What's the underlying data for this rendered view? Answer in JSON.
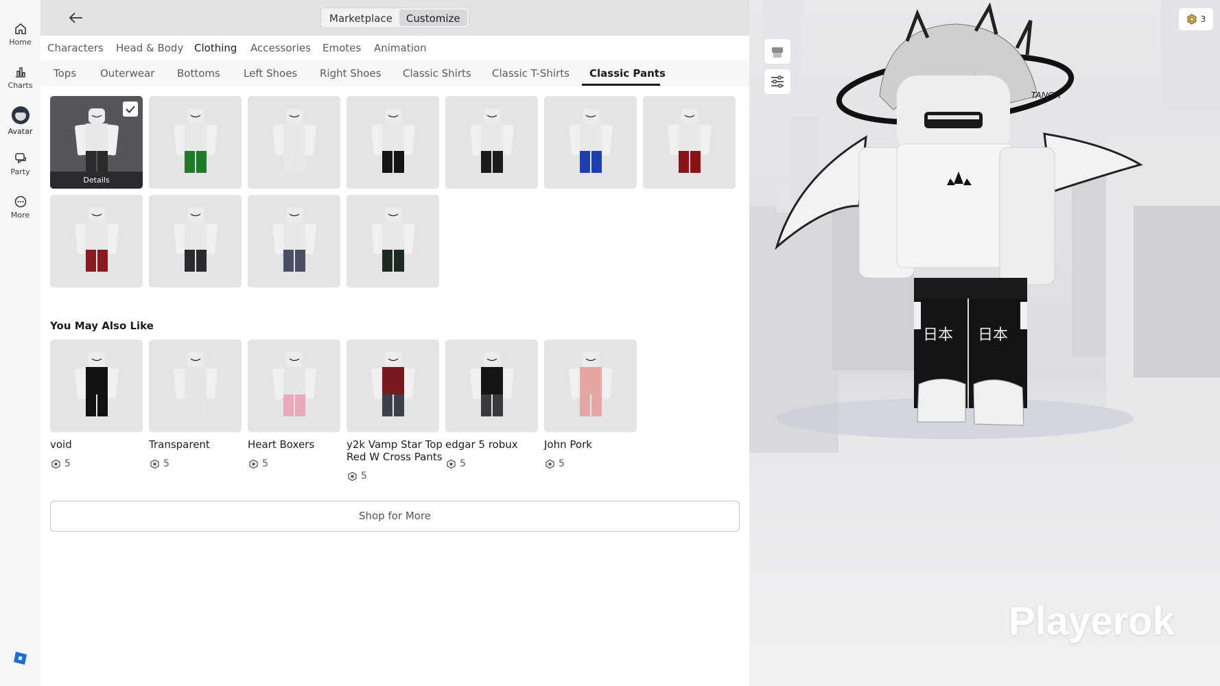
{
  "nav": {
    "items": [
      {
        "label": "Home",
        "icon": "home-icon"
      },
      {
        "label": "Charts",
        "icon": "chart-icon"
      },
      {
        "label": "Avatar",
        "icon": "avatar-icon"
      },
      {
        "label": "Party",
        "icon": "party-icon"
      },
      {
        "label": "More",
        "icon": "more-icon"
      }
    ]
  },
  "header": {
    "segments": [
      "Marketplace",
      "Customize"
    ],
    "active_segment": "Customize"
  },
  "category_tabs": [
    "Characters",
    "Head & Body",
    "Clothing",
    "Accessories",
    "Emotes",
    "Animation"
  ],
  "active_category": "Clothing",
  "sub_tabs": [
    "Tops",
    "Outerwear",
    "Bottoms",
    "Left Shoes",
    "Right Shoes",
    "Classic Shirts",
    "Classic T-Shirts",
    "Classic Pants"
  ],
  "active_sub_tab": "Classic Pants",
  "owned_items": [
    {
      "pants_color": "#2a2a2a",
      "selected": true
    },
    {
      "pants_color": "#1f7a2a"
    },
    {
      "pants_color": "#e8e8e8"
    },
    {
      "pants_color": "#151515"
    },
    {
      "pants_color": "#1c1c1c"
    },
    {
      "pants_color": "#1f3fae"
    },
    {
      "pants_color": "#8a1414"
    },
    {
      "pants_color": "#8a1a22"
    },
    {
      "pants_color": "#2b2b2f"
    },
    {
      "pants_color": "#4a4e63"
    },
    {
      "pants_color": "#1d2a22"
    }
  ],
  "details_label": "Details",
  "recommendations": {
    "title": "You May Also Like",
    "items": [
      {
        "name": "void",
        "price": "5",
        "shirt_color": "#111111",
        "pants_color": "#111111"
      },
      {
        "name": "Transparent",
        "price": "5",
        "shirt_color": "#e6e6e6",
        "pants_color": "#e6e6e6"
      },
      {
        "name": "Heart Boxers",
        "price": "5",
        "shirt_color": "#e6e6e6",
        "pants_color": "#e8a9b8"
      },
      {
        "name": "y2k Vamp Star Top Red W Cross Pants",
        "price": "5",
        "shirt_color": "#7a1822",
        "pants_color": "#3d3f4a"
      },
      {
        "name": "edgar 5 robux",
        "price": "5",
        "shirt_color": "#151515",
        "pants_color": "#3a3a3e"
      },
      {
        "name": "John Pork",
        "price": "5",
        "shirt_color": "#e8a5a5",
        "pants_color": "#e8a5a5"
      }
    ]
  },
  "shop_more_label": "Shop for More",
  "robux_count": "3",
  "player_name": "Playerok",
  "colors": {
    "tile_bg": "#e4e4e7",
    "selected_tile_bg": "#56565a",
    "accent": "#1c1c1c"
  }
}
